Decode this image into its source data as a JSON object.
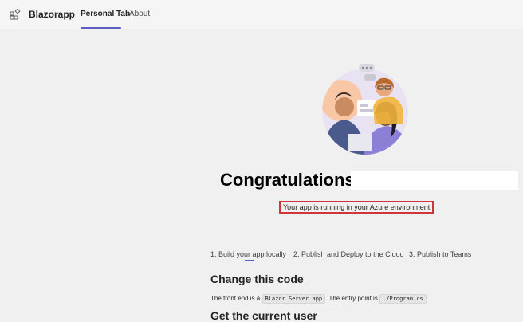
{
  "header": {
    "app_name": "Blazorapp",
    "tabs": [
      {
        "label": "Personal Tab",
        "active": true
      },
      {
        "label": "About",
        "active": false
      }
    ]
  },
  "main": {
    "heading": "Congratulations,",
    "status": "Your app is running in your Azure environment",
    "steps": [
      "1. Build your app locally",
      "2. Publish and Deploy to the Cloud",
      "3. Publish to Teams"
    ],
    "section_change": {
      "title": "Change this code",
      "text_1": "The front end is a",
      "code_1": "Blazor Server app",
      "text_2": ". The entry point is",
      "code_2": "./Program.cs",
      "text_3": "."
    },
    "section_user": {
      "title": "Get the current user"
    }
  },
  "colors": {
    "accent": "#5b5fc7",
    "highlight_border": "#d13438"
  }
}
